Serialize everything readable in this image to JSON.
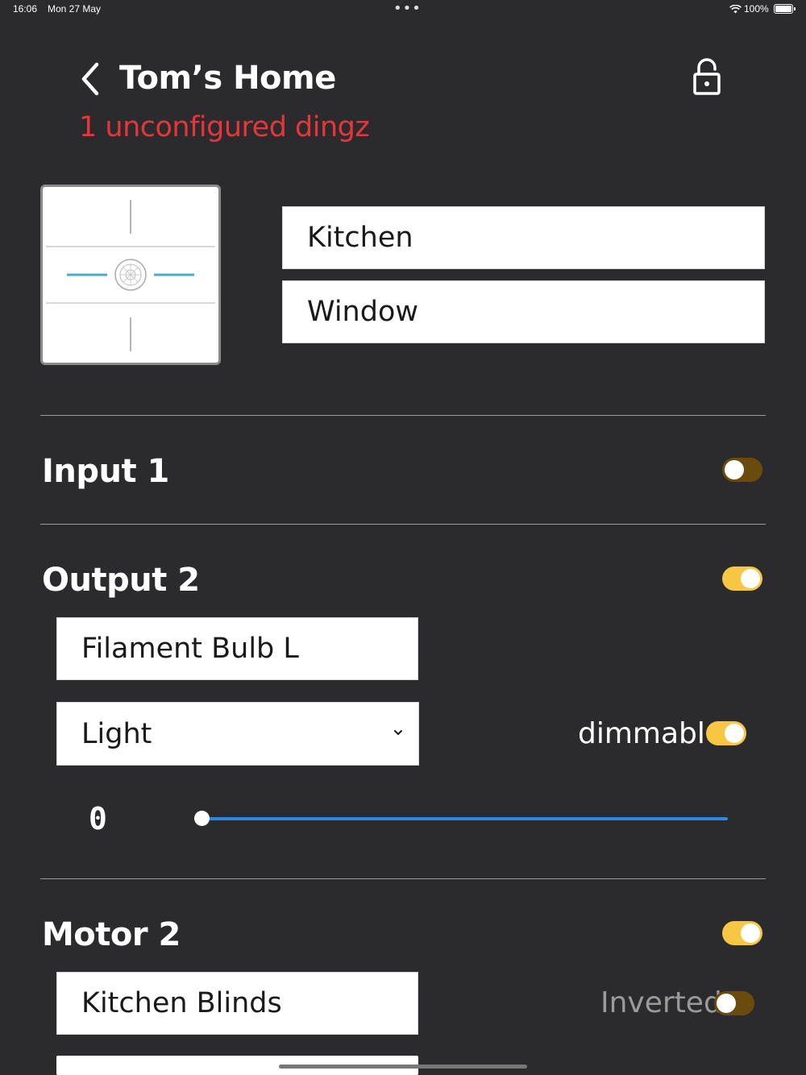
{
  "status_bar": {
    "time": "16:06",
    "date": "Mon 27 May",
    "battery": "100%"
  },
  "header": {
    "title": "Tom’s Home",
    "subtitle": "1 unconfigured dingz",
    "back_icon": "chevron-left-icon",
    "lock_icon": "unlock-icon"
  },
  "device": {
    "room": "Kitchen",
    "name": "Window"
  },
  "sections": {
    "input1": {
      "title": "Input 1",
      "enabled": false
    },
    "output2": {
      "title": "Output 2",
      "enabled": true,
      "name": "Filament Bulb L",
      "type": "Light",
      "dimmable_label": "dimmable",
      "dimmable": true,
      "level": "0"
    },
    "motor2": {
      "title": "Motor 2",
      "enabled": true,
      "name": "Kitchen Blinds",
      "inverted_label": "Inverted",
      "inverted": false
    }
  },
  "colors": {
    "background": "#2b2b2d",
    "accent_red": "#e5363a",
    "toggle_on": "#f7c744",
    "toggle_off": "#6b4a0e",
    "slider": "#2f86e0"
  }
}
